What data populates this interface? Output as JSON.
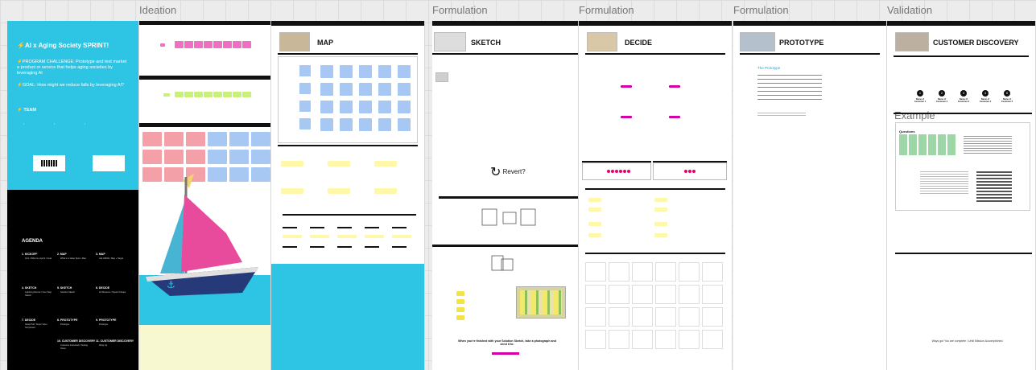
{
  "frame_labels": {
    "ideation": "Ideation",
    "formulation_1": "Formulation",
    "formulation_2": "Formulation",
    "formulation_3": "Formulation",
    "validation": "Validation"
  },
  "intro": {
    "title": "AI x Aging Society SPRINT!",
    "challenge": "PROGRAM CHALLENGE: Prototype and test market a product or service that helps aging societies by leveraging AI",
    "goal": "GOAL: How might we reduce falls by leveraging AI?",
    "team": "TEAM",
    "agenda": "AGENDA",
    "agenda_items": [
      {
        "label": "1. KICKOFF",
        "sub": "Intro / What is a sprint / Goal"
      },
      {
        "label": "2. MAP",
        "sub": "What is a Value Spec / Map"
      },
      {
        "label": "3. MAP",
        "sub": "Ask HMWs / Map + Target"
      },
      {
        "label": "4. SKETCH",
        "sub": "Lightning Demos / Four Step Sketch"
      },
      {
        "label": "5. SKETCH",
        "sub": "Solution Sketch"
      },
      {
        "label": "6. DECIDE",
        "sub": "Art Museum / Speed Critique"
      },
      {
        "label": "7. DECIDE",
        "sub": "Straw Poll / Super Vote / Storyboard"
      },
      {
        "label": "8. PROTOTYPE",
        "sub": "Prototype"
      },
      {
        "label": "9. PROTOTYPE",
        "sub": "Prototype"
      },
      {
        "label": "10. CUSTOMER DISCOVERY",
        "sub": "Customer Interviews / Testing Notes"
      },
      {
        "label": "11. CUSTOMER DISCOVERY",
        "sub": "Wrap Up"
      }
    ]
  },
  "map": {
    "title": "MAP"
  },
  "sketch": {
    "title": "SKETCH",
    "revert": "Revert?",
    "footer": "When you're finished with your Solution Sketch, take a photograph and send it to:"
  },
  "decide": {
    "title": "DECIDE"
  },
  "prototype": {
    "title": "PROTOTYPE",
    "subtitle": "The Prototype"
  },
  "customer_discovery": {
    "title": "CUSTOMER DISCOVERY",
    "example": "Example",
    "customers": [
      "Name of Customer 1",
      "Name of Customer 2",
      "Name of Customer 3",
      "Name of Customer 4",
      "Name of Customer 5"
    ],
    "sheet_title": "Questions",
    "footer": "Ways got You are complete / Until Mission Accomplished."
  },
  "colors": {
    "accent_cyan": "#2ec4e4",
    "sticky_pink": "#f06fc4",
    "sticky_green": "#c8f07a",
    "sticky_yellow": "#fff8a8",
    "sticky_blue": "#a8c8f4",
    "sticky_red": "#f4a0a8",
    "magenta": "#d400a8"
  }
}
